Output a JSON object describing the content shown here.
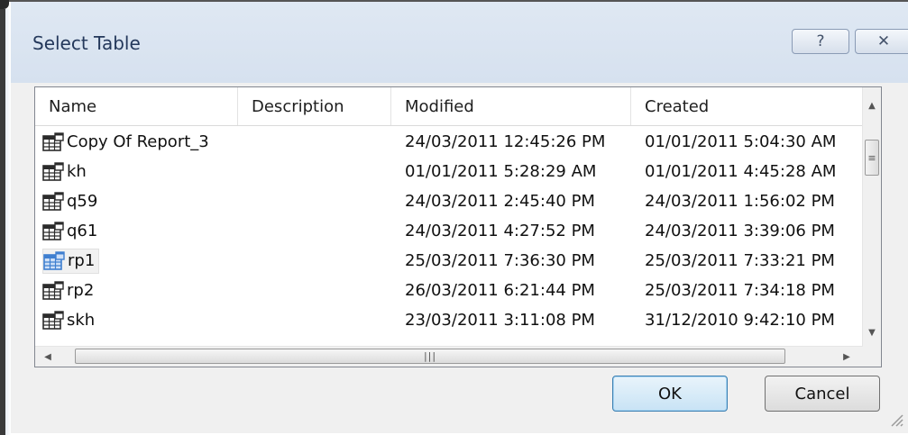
{
  "dialog": {
    "title": "Select Table",
    "help_glyph": "?",
    "close_glyph": "✕"
  },
  "columns": [
    "Name",
    "Description",
    "Modified",
    "Created"
  ],
  "rows": [
    {
      "name": "Copy Of Report_3",
      "description": "",
      "modified": "24/03/2011 12:45:26 PM",
      "created": "01/01/2011 5:04:30 AM"
    },
    {
      "name": "kh",
      "description": "",
      "modified": "01/01/2011 5:28:29 AM",
      "created": "01/01/2011 4:45:28 AM"
    },
    {
      "name": "q59",
      "description": "",
      "modified": "24/03/2011 2:45:40 PM",
      "created": "24/03/2011 1:56:02 PM"
    },
    {
      "name": "q61",
      "description": "",
      "modified": "24/03/2011 4:27:52 PM",
      "created": "24/03/2011 3:39:06 PM"
    },
    {
      "name": "rp1",
      "description": "",
      "modified": "25/03/2011 7:36:30 PM",
      "created": "25/03/2011 7:33:21 PM",
      "selected": true
    },
    {
      "name": "rp2",
      "description": "",
      "modified": "26/03/2011 6:21:44 PM",
      "created": "25/03/2011 7:34:18 PM"
    },
    {
      "name": "skh",
      "description": "",
      "modified": "23/03/2011 3:11:08 PM",
      "created": "31/12/2010 9:42:10 PM"
    }
  ],
  "buttons": {
    "ok": "OK",
    "cancel": "Cancel"
  },
  "colors": {
    "titlebar": "#dae4f1",
    "selection_icon": "#3f7fd0"
  }
}
